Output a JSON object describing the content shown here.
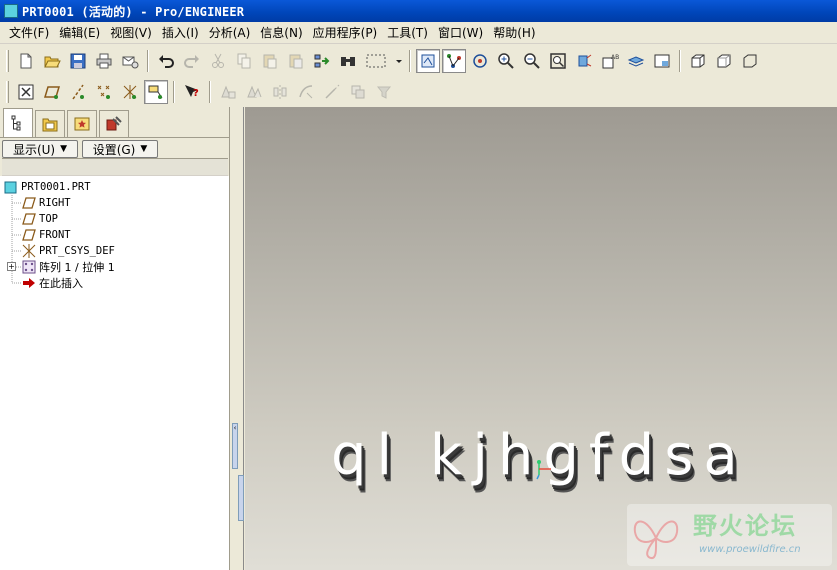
{
  "window": {
    "title": "PRT0001 (活动的) - Pro/ENGINEER"
  },
  "menubar": {
    "items": [
      "文件(F)",
      "编辑(E)",
      "视图(V)",
      "插入(I)",
      "分析(A)",
      "信息(N)",
      "应用程序(P)",
      "工具(T)",
      "窗口(W)",
      "帮助(H)"
    ]
  },
  "panel": {
    "show_label": "显示(U)",
    "settings_label": "设置(G)"
  },
  "model_tree": {
    "root": "PRT0001.PRT",
    "items": [
      "RIGHT",
      "TOP",
      "FRONT",
      "PRT_CSYS_DEF",
      "阵列 1 / 拉伸 1",
      "在此插入"
    ]
  },
  "viewport": {
    "model_text": "ql kjhgfdsa"
  },
  "watermark": {
    "title": "野火论坛",
    "url": "www.proewildfire.cn"
  },
  "colors": {
    "title_bar": "#0a58d8",
    "accent": "#5bd1e0",
    "insert_arrow": "#c00000"
  }
}
